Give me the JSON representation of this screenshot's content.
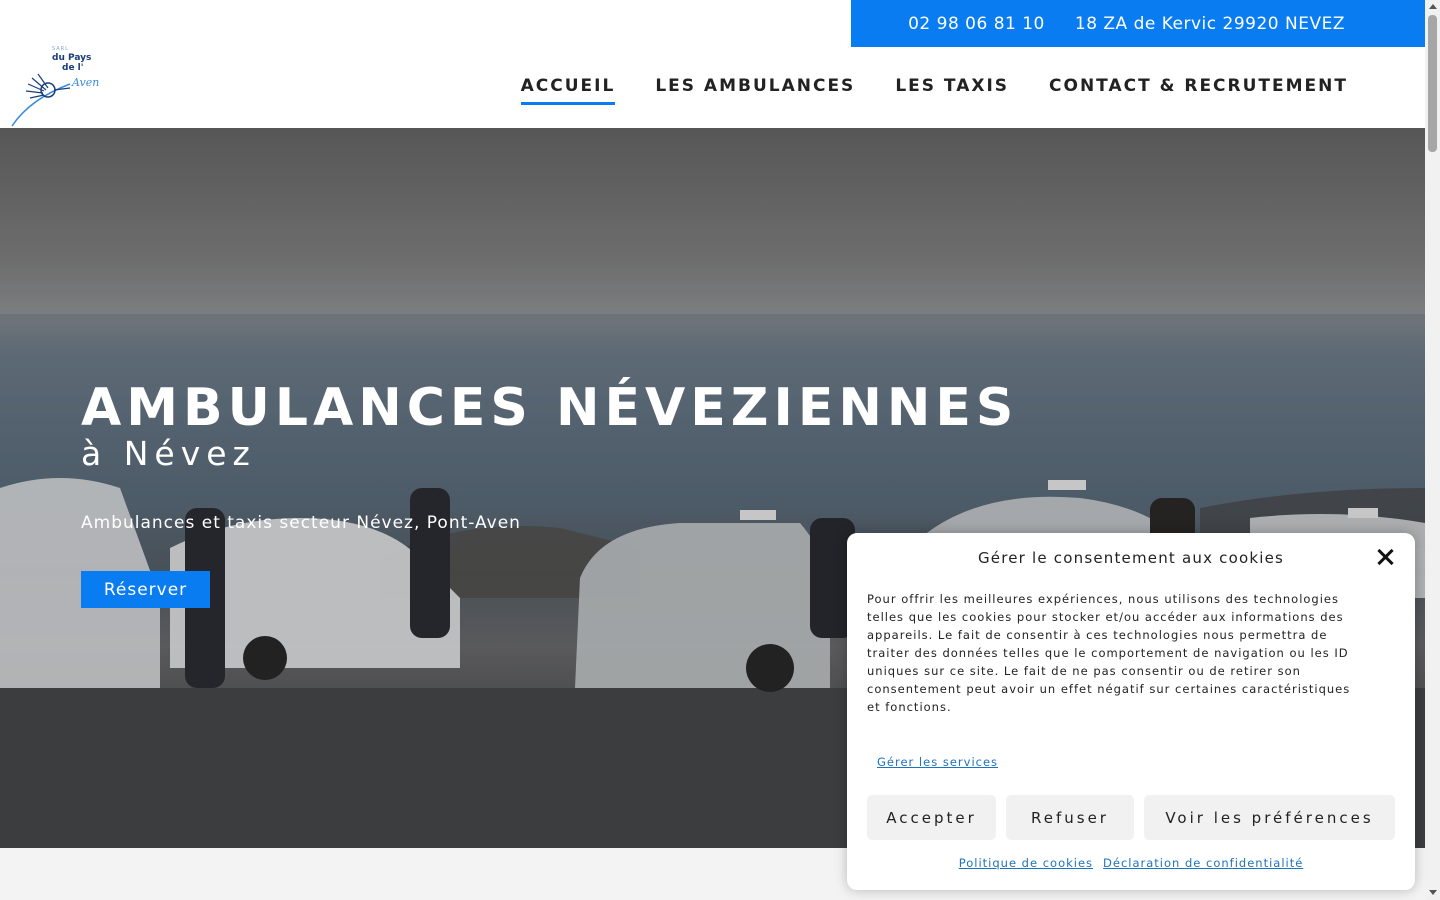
{
  "topbar": {
    "phone": "02 98 06 81 10",
    "address": "18 ZA de Kervic 29920 NEVEZ"
  },
  "logo": {
    "sarl": "SARL",
    "line1": "du Pays",
    "line2": "de l'",
    "line3": "Aven"
  },
  "nav": {
    "items": [
      {
        "label": "ACCUEIL",
        "active": true
      },
      {
        "label": "LES AMBULANCES",
        "active": false
      },
      {
        "label": "LES TAXIS",
        "active": false
      },
      {
        "label": "CONTACT & RECRUTEMENT",
        "active": false
      }
    ]
  },
  "hero": {
    "title": "AMBULANCES NÉVEZIENNES",
    "subtitle": "à Névez",
    "text": "Ambulances et taxis secteur Névez, Pont-Aven",
    "button": "Réserver"
  },
  "cookie": {
    "title": "Gérer le consentement aux cookies",
    "body": "Pour offrir les meilleures expériences, nous utilisons des technologies telles que les cookies pour stocker et/ou accéder aux informations des appareils. Le fait de consentir à ces technologies nous permettra de traiter des données telles que le comportement de navigation ou les ID uniques sur ce site. Le fait de ne pas consentir ou de retirer son consentement peut avoir un effet négatif sur certaines caractéristiques et fonctions.",
    "manage_link": "Gérer les services",
    "accept": "Accepter",
    "refuse": "Refuser",
    "preferences": "Voir les préférences",
    "policy_link": "Politique de cookies",
    "privacy_link": "Déclaration de confidentialité"
  },
  "colors": {
    "accent": "#0a7cf2",
    "link": "#1e73be"
  }
}
